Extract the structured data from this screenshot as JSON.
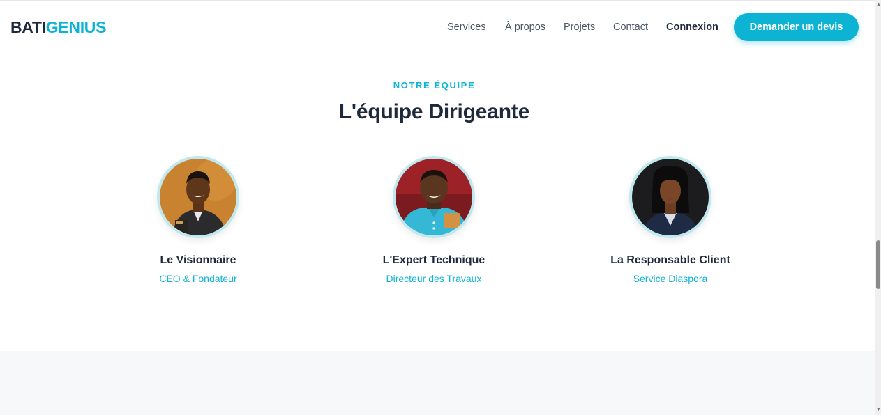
{
  "header": {
    "logo_part1": "BATI",
    "logo_part2": "GENIUS",
    "nav": [
      "Services",
      "À propos",
      "Projets",
      "Contact"
    ],
    "login": "Connexion",
    "cta": "Demander un devis"
  },
  "team": {
    "eyebrow": "NOTRE ÉQUIPE",
    "title": "L'équipe Dirigeante",
    "members": [
      {
        "name": "Le Visionnaire",
        "role": "CEO & Fondateur"
      },
      {
        "name": "L'Expert Technique",
        "role": "Directeur des Travaux"
      },
      {
        "name": "La Responsable Client",
        "role": "Service Diaspora"
      }
    ]
  },
  "colors": {
    "accent": "#0db3d3",
    "heading": "#1e293b",
    "band": "#f7f8fa"
  }
}
